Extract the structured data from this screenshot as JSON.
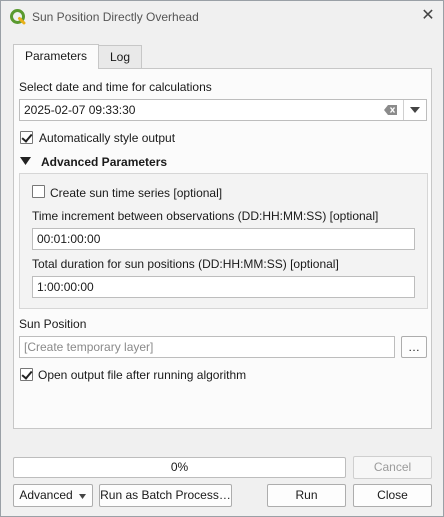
{
  "window": {
    "title": "Sun Position Directly Overhead",
    "close_glyph": "✕"
  },
  "tabs": [
    {
      "label": "Parameters",
      "active": true
    },
    {
      "label": "Log",
      "active": false
    }
  ],
  "params": {
    "datetime_label": "Select date and time for calculations",
    "datetime_value": "2025-02-07 09:33:30",
    "auto_style_label": "Automatically style output",
    "auto_style_checked": true,
    "advanced_header": "Advanced Parameters",
    "advanced": {
      "time_series_label": "Create sun time series [optional]",
      "time_series_checked": false,
      "increment_label": "Time increment between observations (DD:HH:MM:SS) [optional]",
      "increment_value": "00:01:00:00",
      "duration_label": "Total duration for sun positions (DD:HH:MM:SS) [optional]",
      "duration_value": "1:00:00:00"
    },
    "output_label": "Sun Position",
    "output_placeholder": "[Create temporary layer]",
    "output_browse_label": "…",
    "open_output_label": "Open output file after running algorithm",
    "open_output_checked": true
  },
  "progress": {
    "text": "0%",
    "value": 0
  },
  "buttons": {
    "cancel": "Cancel",
    "advanced": "Advanced",
    "batch": "Run as Batch Process…",
    "run": "Run",
    "close": "Close"
  },
  "colors": {
    "accent": "#3b7dd8",
    "qgis_green": "#5a9a2f"
  }
}
